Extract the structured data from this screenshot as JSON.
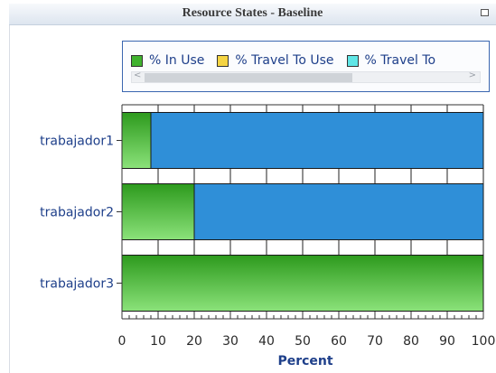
{
  "window": {
    "title": "Resource States - Baseline"
  },
  "legend": {
    "items": [
      {
        "label": "% In Use",
        "color": "#3fb22e"
      },
      {
        "label": "% Travel To Use",
        "color": "#f5d442"
      },
      {
        "label": "% Travel To",
        "color": "#5fe6e6"
      }
    ]
  },
  "chart_data": {
    "type": "bar",
    "orientation": "horizontal",
    "stacked": true,
    "categories": [
      "trabajador1",
      "trabajador2",
      "trabajador3"
    ],
    "series": [
      {
        "name": "% In Use",
        "color": "#3fb22e",
        "values": [
          8,
          20,
          100
        ]
      },
      {
        "name": "",
        "color": "#2f8fd8",
        "values": [
          92,
          80,
          0
        ]
      }
    ],
    "xlabel": "Percent",
    "xlim": [
      0,
      100
    ],
    "xticks": [
      0,
      10,
      20,
      30,
      40,
      50,
      60,
      70,
      80,
      90,
      100
    ],
    "grid": true,
    "legend_position": "top"
  }
}
